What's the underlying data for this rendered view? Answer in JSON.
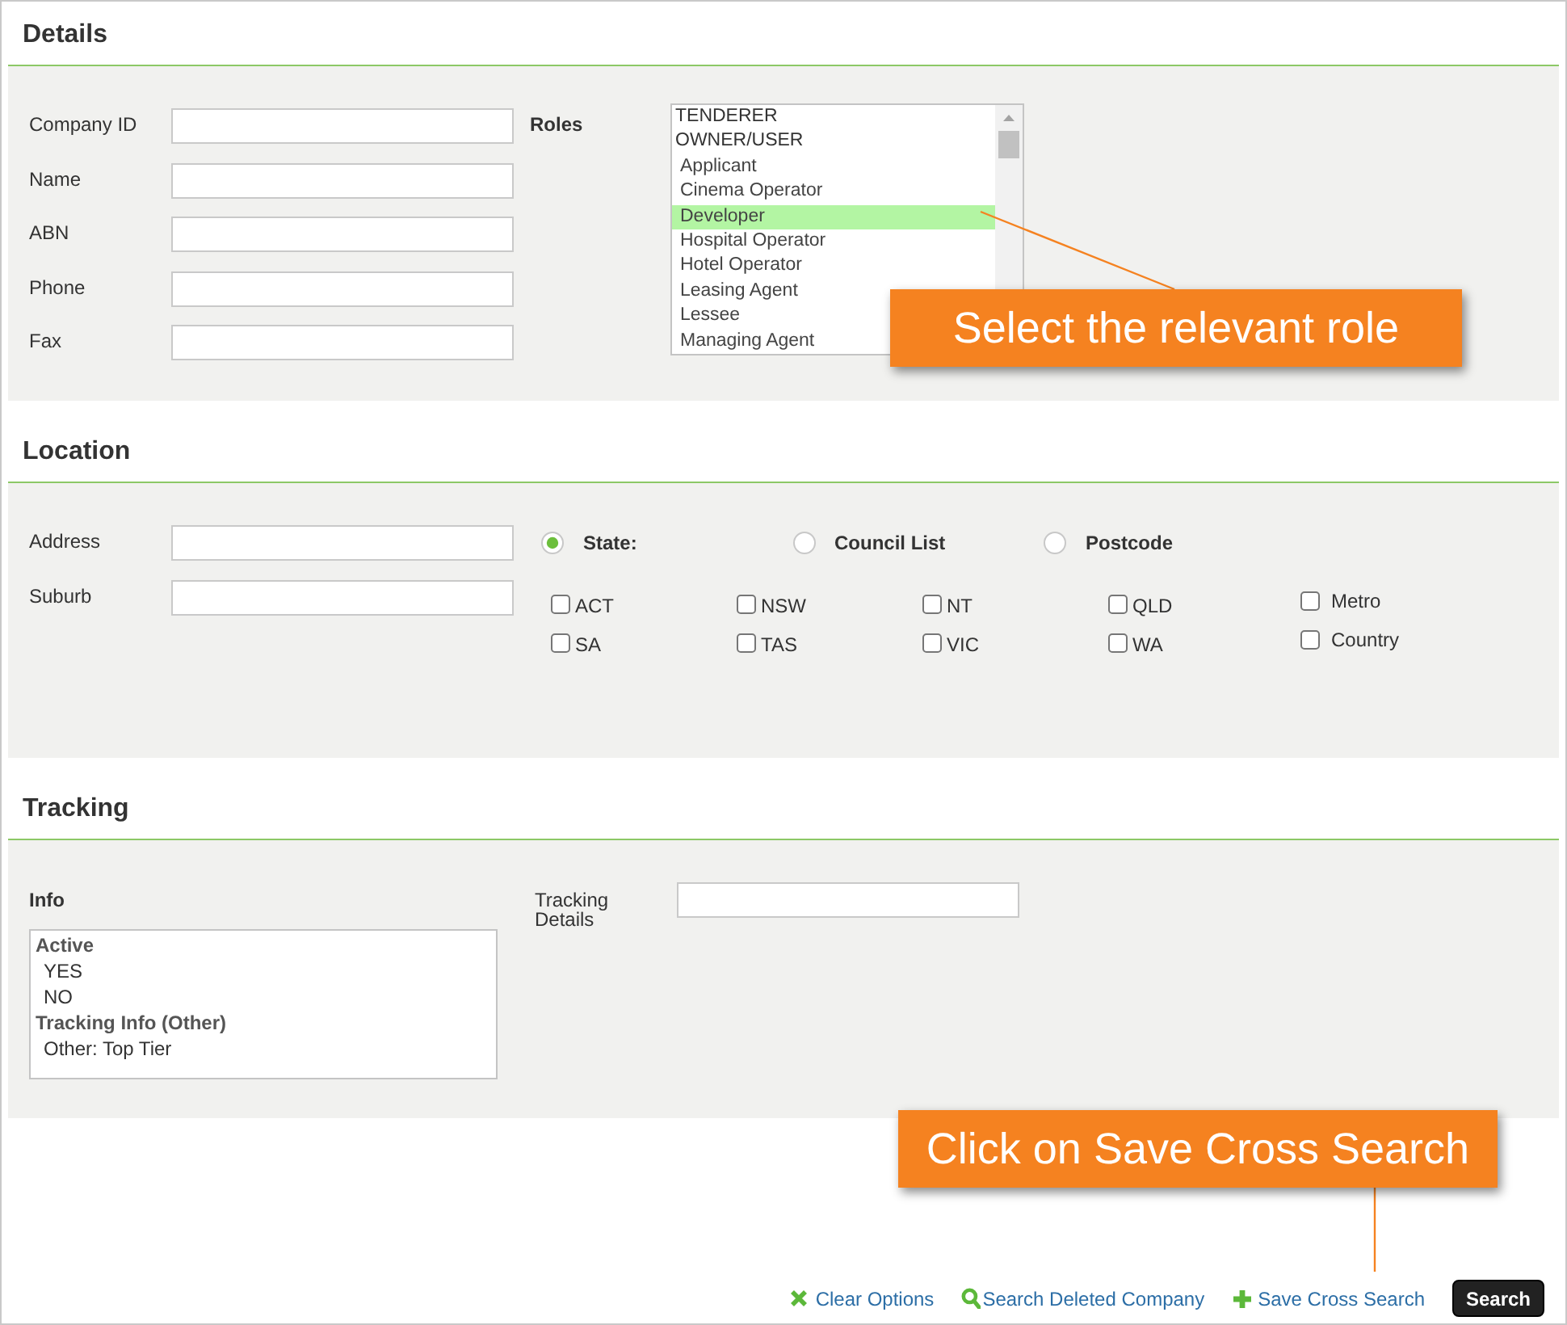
{
  "details": {
    "title": "Details",
    "fields": [
      {
        "label": "Company ID"
      },
      {
        "label": "Name"
      },
      {
        "label": "ABN"
      },
      {
        "label": "Phone"
      },
      {
        "label": "Fax"
      }
    ],
    "roles": {
      "label": "Roles",
      "items": [
        {
          "text": "TENDERER",
          "kind": "category",
          "selected": false
        },
        {
          "text": "OWNER/USER",
          "kind": "category",
          "selected": false
        },
        {
          "text": "Applicant",
          "kind": "option",
          "selected": false
        },
        {
          "text": "Cinema Operator",
          "kind": "option",
          "selected": false
        },
        {
          "text": "Developer",
          "kind": "option",
          "selected": true
        },
        {
          "text": "Hospital Operator",
          "kind": "option",
          "selected": false
        },
        {
          "text": "Hotel Operator",
          "kind": "option",
          "selected": false
        },
        {
          "text": "Leasing Agent",
          "kind": "option",
          "selected": false
        },
        {
          "text": "Lessee",
          "kind": "option",
          "selected": false
        },
        {
          "text": "Managing Agent",
          "kind": "option",
          "selected": false
        }
      ]
    }
  },
  "location": {
    "title": "Location",
    "fields": [
      {
        "label": "Address"
      },
      {
        "label": "Suburb"
      }
    ],
    "radios": [
      {
        "label": "State:",
        "selected": true
      },
      {
        "label": "Council List",
        "selected": false
      },
      {
        "label": "Postcode",
        "selected": false
      }
    ],
    "checkboxes": [
      {
        "label": "ACT",
        "kind": "state",
        "checked": false
      },
      {
        "label": "NSW",
        "kind": "state",
        "checked": false
      },
      {
        "label": "NT",
        "kind": "state",
        "checked": false
      },
      {
        "label": "QLD",
        "kind": "state",
        "checked": false
      },
      {
        "label": "Metro",
        "kind": "region",
        "checked": false
      },
      {
        "label": "SA",
        "kind": "state",
        "checked": false
      },
      {
        "label": "TAS",
        "kind": "state",
        "checked": false
      },
      {
        "label": "VIC",
        "kind": "state",
        "checked": false
      },
      {
        "label": "WA",
        "kind": "state",
        "checked": false
      },
      {
        "label": "Country",
        "kind": "region",
        "checked": false
      }
    ]
  },
  "tracking": {
    "title": "Tracking",
    "info": {
      "label": "Info",
      "items": [
        {
          "text": "Active",
          "kind": "group",
          "selected": false
        },
        {
          "text": "YES",
          "kind": "option",
          "selected": false
        },
        {
          "text": "NO",
          "kind": "option",
          "selected": false
        },
        {
          "text": "Tracking Info (Other)",
          "kind": "group",
          "selected": false
        },
        {
          "text": "Other: Top Tier",
          "kind": "option",
          "selected": false
        }
      ]
    },
    "details_field": {
      "label": "Tracking Details"
    }
  },
  "footer": {
    "links": [
      {
        "text": "Clear Options",
        "kind": "clear"
      },
      {
        "text": "Search Deleted Company",
        "kind": "search"
      },
      {
        "text": "Save Cross Search",
        "kind": "add"
      }
    ],
    "button": "Search"
  },
  "callouts": [
    {
      "text": "Select the relevant role",
      "kind": "roles"
    },
    {
      "text": "Click on Save Cross Search",
      "kind": "save"
    }
  ]
}
